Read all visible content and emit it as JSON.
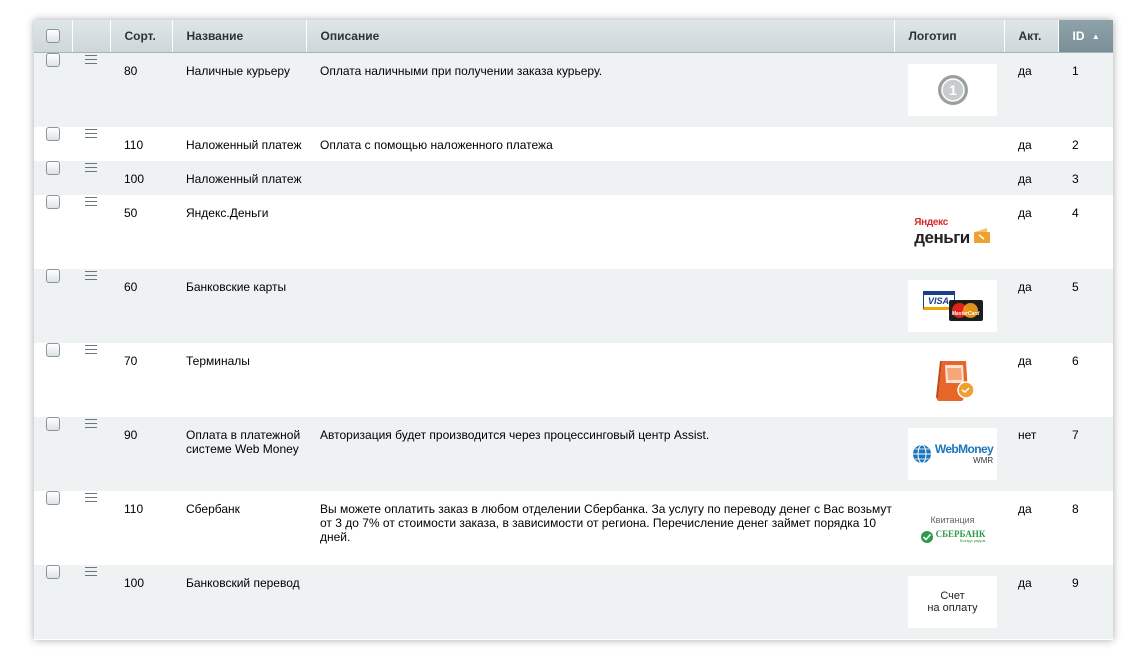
{
  "table": {
    "headers": {
      "sort": "Сорт.",
      "name": "Название",
      "description": "Описание",
      "logo": "Логотип",
      "active": "Акт.",
      "id": "ID",
      "sort_indicator": "▲"
    },
    "rows": [
      {
        "sort": "80",
        "name": "Наличные курьеру",
        "description": "Оплата наличными при получении заказа курьеру.",
        "logo": "cash-number-logo",
        "active": "да",
        "id": "1"
      },
      {
        "sort": "110",
        "name": "Наложенный платеж",
        "description": "Оплата с помощью наложенного платежа",
        "logo": "",
        "active": "да",
        "id": "2"
      },
      {
        "sort": "100",
        "name": "Наложенный платеж",
        "description": "",
        "logo": "",
        "active": "да",
        "id": "3"
      },
      {
        "sort": "50",
        "name": "Яндекс.Деньги",
        "description": "",
        "logo": "yandex-money-logo",
        "active": "да",
        "id": "4"
      },
      {
        "sort": "60",
        "name": "Банковские карты",
        "description": "",
        "logo": "visa-mastercard-logo",
        "active": "да",
        "id": "5"
      },
      {
        "sort": "70",
        "name": "Терминалы",
        "description": "",
        "logo": "terminal-logo",
        "active": "да",
        "id": "6"
      },
      {
        "sort": "90",
        "name": "Оплата в платежной системе Web Money",
        "description": "Авторизация будет производится через процессинговый центр Assist.",
        "logo": "webmoney-logo",
        "active": "нет",
        "id": "7"
      },
      {
        "sort": "110",
        "name": "Сбербанк",
        "description": "Вы можете оплатить заказ в любом отделении Сбербанка. За услугу по переводу денег с Вас возьмут от 3 до 7% от стоимости заказа, в зависимости от региона. Перечисление денег займет порядка 10 дней.",
        "logo": "sberbank-logo",
        "active": "да",
        "id": "8"
      },
      {
        "sort": "100",
        "name": "Банковский перевод",
        "description": "",
        "logo": "invoice-logo",
        "active": "да",
        "id": "9"
      }
    ]
  },
  "logos": {
    "cash_digit": "1",
    "yandex_top": "Яндекс",
    "yandex_bottom": "деньги",
    "visa": "VISA",
    "mastercard": "MasterCard",
    "webmoney_top": "WebMoney",
    "webmoney_bottom": "WMR",
    "sber_top": "Квитанция",
    "sber_name": "СБЕРБАНК",
    "sber_slogan": "Всегда рядом",
    "invoice_line1": "Счет",
    "invoice_line2": "на оплату"
  },
  "colors": {
    "header_bg": "#d5dde0",
    "header_sorted_bg": "#8196a0",
    "row_alt_bg": "#eef2f3",
    "id_link": "#1e5fa5",
    "yandex_orange": "#f0a030",
    "terminal_orange": "#e8662a",
    "webmoney_blue": "#1a76bd",
    "sberbank_green": "#2e9b48"
  }
}
